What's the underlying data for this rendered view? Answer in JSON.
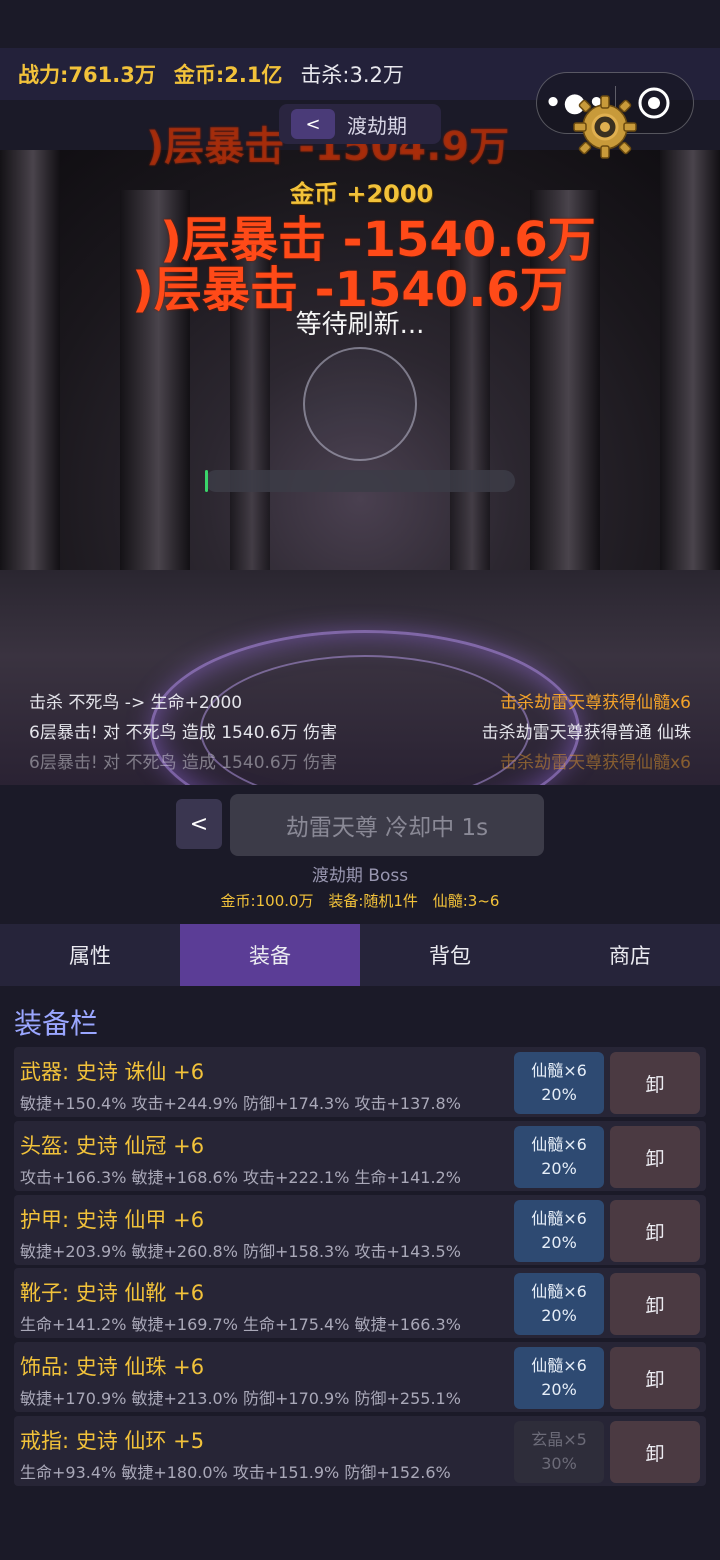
{
  "topbar": {
    "power": "战力:761.3万",
    "gold": "金币:2.1亿",
    "kills": "击杀:3.2万"
  },
  "realm": {
    "back": "<",
    "name": "渡劫期"
  },
  "battle": {
    "dmg_ghost": ")层暴击 -1504.9万",
    "dmg1": ")层暴击 -1540.6万",
    "dmg2": ")层暴击 -1540.6万",
    "gold_float": "金币 +2000",
    "status": "等待刷新...",
    "hp_percent": 1,
    "log_left": [
      "击杀 不死鸟 -> 生命+2000",
      "6层暴击! 对 不死鸟 造成 1540.6万 伤害",
      "6层暴击! 对 不死鸟 造成 1540.6万 伤害"
    ],
    "log_right": [
      "击杀劫雷天尊获得仙髓x6",
      "击杀劫雷天尊获得普通 仙珠",
      "击杀劫雷天尊获得仙髓x6"
    ]
  },
  "boss": {
    "prev": "<",
    "button": "劫雷天尊 冷却中 1s",
    "title": "渡劫期 Boss",
    "reward_gold": "金币:100.0万",
    "reward_equip": "装备:随机1件",
    "reward_marrow": "仙髓:3~6"
  },
  "tabs": [
    "属性",
    "装备",
    "背包",
    "商店"
  ],
  "panel_title": "装备栏",
  "equipment": [
    {
      "title": "武器: 史诗 诛仙 +6",
      "stats": "敏捷+150.4% 攻击+244.9% 防御+174.3% 攻击+137.8%",
      "cost": "仙髓×6",
      "rate": "20%",
      "unequip": "卸",
      "enabled": true
    },
    {
      "title": "头盔: 史诗 仙冠 +6",
      "stats": "攻击+166.3% 敏捷+168.6% 攻击+222.1% 生命+141.2%",
      "cost": "仙髓×6",
      "rate": "20%",
      "unequip": "卸",
      "enabled": true
    },
    {
      "title": "护甲: 史诗 仙甲 +6",
      "stats": "敏捷+203.9% 敏捷+260.8% 防御+158.3% 攻击+143.5%",
      "cost": "仙髓×6",
      "rate": "20%",
      "unequip": "卸",
      "enabled": true
    },
    {
      "title": "靴子: 史诗 仙靴 +6",
      "stats": "生命+141.2% 敏捷+169.7% 生命+175.4% 敏捷+166.3%",
      "cost": "仙髓×6",
      "rate": "20%",
      "unequip": "卸",
      "enabled": true
    },
    {
      "title": "饰品: 史诗 仙珠 +6",
      "stats": "敏捷+170.9% 敏捷+213.0% 防御+170.9% 防御+255.1%",
      "cost": "仙髓×6",
      "rate": "20%",
      "unequip": "卸",
      "enabled": true
    },
    {
      "title": "戒指: 史诗 仙环 +5",
      "stats": "生命+93.4% 敏捷+180.0% 攻击+151.9% 防御+152.6%",
      "cost": "玄晶×5",
      "rate": "30%",
      "unequip": "卸",
      "enabled": false
    }
  ]
}
